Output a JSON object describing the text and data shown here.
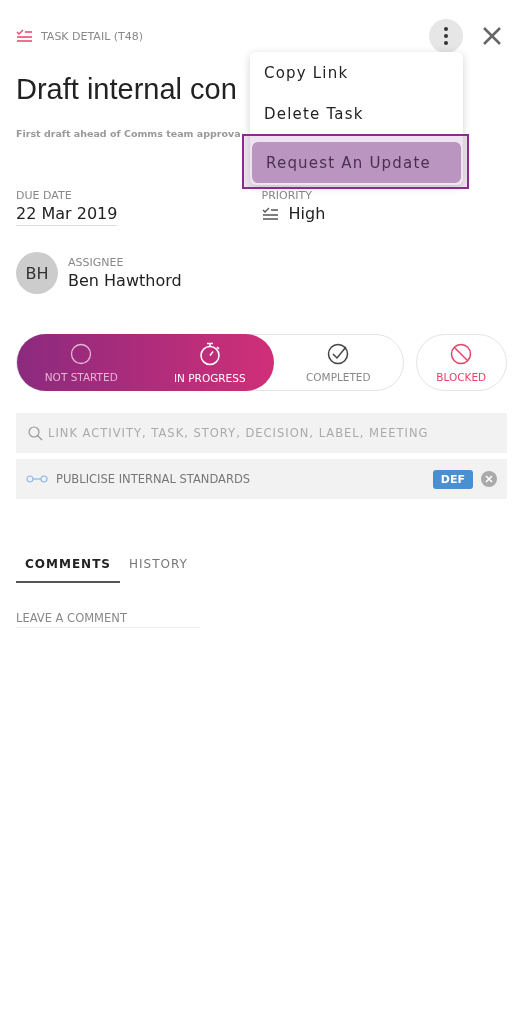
{
  "header": {
    "label": "TASK DETAIL (T48)"
  },
  "title": "Draft internal con",
  "subtitle": "First draft ahead of Comms team approva",
  "due_date": {
    "label": "DUE DATE",
    "value": "22 Mar 2019"
  },
  "priority": {
    "label": "PRIORITY",
    "value": "High"
  },
  "assignee": {
    "label": "ASSIGNEE",
    "initials": "BH",
    "name": "Ben Hawthord"
  },
  "status_options": [
    {
      "kind": "circle",
      "label": "NOT STARTED",
      "selected": false
    },
    {
      "kind": "timer",
      "label": "IN PROGRESS",
      "selected": true
    },
    {
      "kind": "check",
      "label": "COMPLETED",
      "selected": false
    }
  ],
  "blocked": {
    "label": "BLOCKED",
    "selected": false
  },
  "search": {
    "placeholder": "LINK ACTIVITY, TASK, STORY, DECISION, LABEL, MEETING"
  },
  "links": [
    {
      "label": "PUBLICISE INTERNAL STANDARDS",
      "tag": "DEF",
      "color": "#4a90d0"
    }
  ],
  "tabs": [
    {
      "label": "COMMENTS",
      "selected": true
    },
    {
      "label": "HISTORY",
      "selected": false
    }
  ],
  "comment": {
    "placeholder": "LEAVE A COMMENT"
  },
  "menu": {
    "items": [
      {
        "label": "Copy Link",
        "selected": false
      },
      {
        "label": "Delete Task",
        "selected": false
      },
      {
        "label": "Request An Update",
        "selected": true
      }
    ]
  }
}
